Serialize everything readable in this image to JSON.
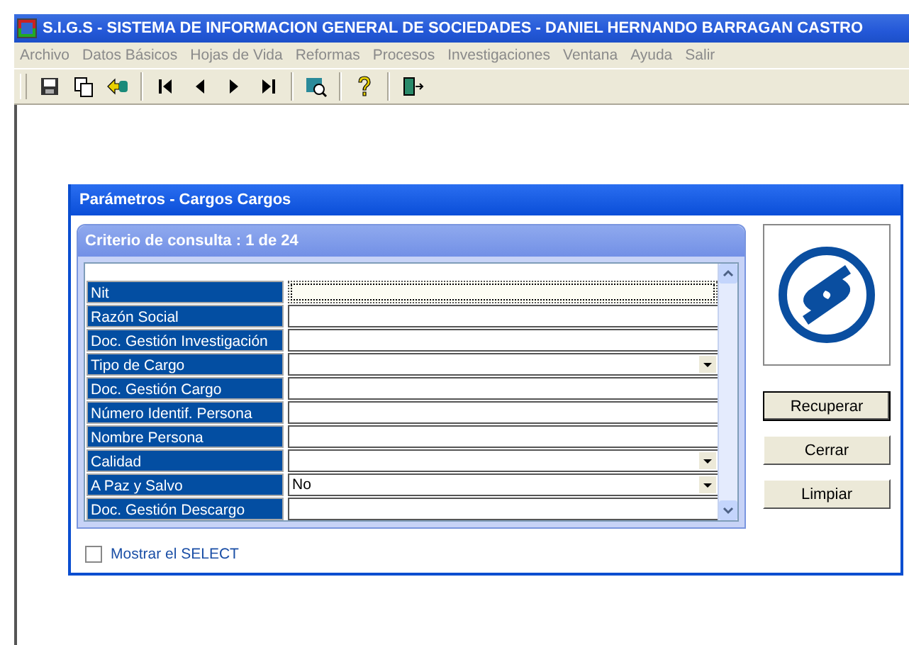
{
  "window": {
    "title": "S.I.G.S   - SISTEMA DE INFORMACION GENERAL DE SOCIEDADES - DANIEL HERNANDO BARRAGAN CASTRO"
  },
  "menu": [
    {
      "label": "Archivo",
      "disabled": true
    },
    {
      "label": "Datos Básicos",
      "disabled": true
    },
    {
      "label": "Hojas de Vida",
      "disabled": true
    },
    {
      "label": "Reformas",
      "disabled": true
    },
    {
      "label": "Procesos",
      "disabled": true
    },
    {
      "label": "Investigaciones",
      "disabled": true
    },
    {
      "label": "Ventana",
      "disabled": true
    },
    {
      "label": "Ayuda",
      "disabled": true
    },
    {
      "label": "Salir",
      "disabled": true
    }
  ],
  "toolbar": [
    {
      "kind": "save"
    },
    {
      "kind": "copy"
    },
    {
      "kind": "back"
    },
    {
      "kind": "sep"
    },
    {
      "kind": "first"
    },
    {
      "kind": "prev"
    },
    {
      "kind": "next"
    },
    {
      "kind": "last"
    },
    {
      "kind": "sep"
    },
    {
      "kind": "search"
    },
    {
      "kind": "sep"
    },
    {
      "kind": "help"
    },
    {
      "kind": "sep"
    },
    {
      "kind": "exit"
    }
  ],
  "dialog": {
    "title": "Parámetros - Cargos Cargos",
    "panel_title": "Criterio de consulta : 1  de  24",
    "fields": [
      {
        "label": "Nit",
        "kind": "text",
        "focused": true
      },
      {
        "label": "Razón Social",
        "kind": "text",
        "focused": false
      },
      {
        "label": "Doc. Gestión Investigación",
        "kind": "text",
        "focused": false
      },
      {
        "label": "Tipo de Cargo",
        "kind": "dropdown",
        "focused": false
      },
      {
        "label": "Doc. Gestión Cargo",
        "kind": "text",
        "focused": false
      },
      {
        "label": "Número Identif. Persona",
        "kind": "text",
        "focused": false
      },
      {
        "label": "Nombre Persona",
        "kind": "text",
        "focused": false
      },
      {
        "label": "Calidad",
        "kind": "dropdown",
        "focused": false
      },
      {
        "label": "A Paz y Salvo",
        "kind": "dropdown",
        "value": "No",
        "focused": false
      },
      {
        "label": "Doc. Gestión Descargo",
        "kind": "text",
        "focused": false
      }
    ],
    "buttons": [
      {
        "label": "Recuperar",
        "default": true
      },
      {
        "label": "Cerrar",
        "default": false
      },
      {
        "label": "Limpiar",
        "default": false
      }
    ],
    "show_select": {
      "label": "Mostrar el SELECT",
      "checked": false
    }
  }
}
